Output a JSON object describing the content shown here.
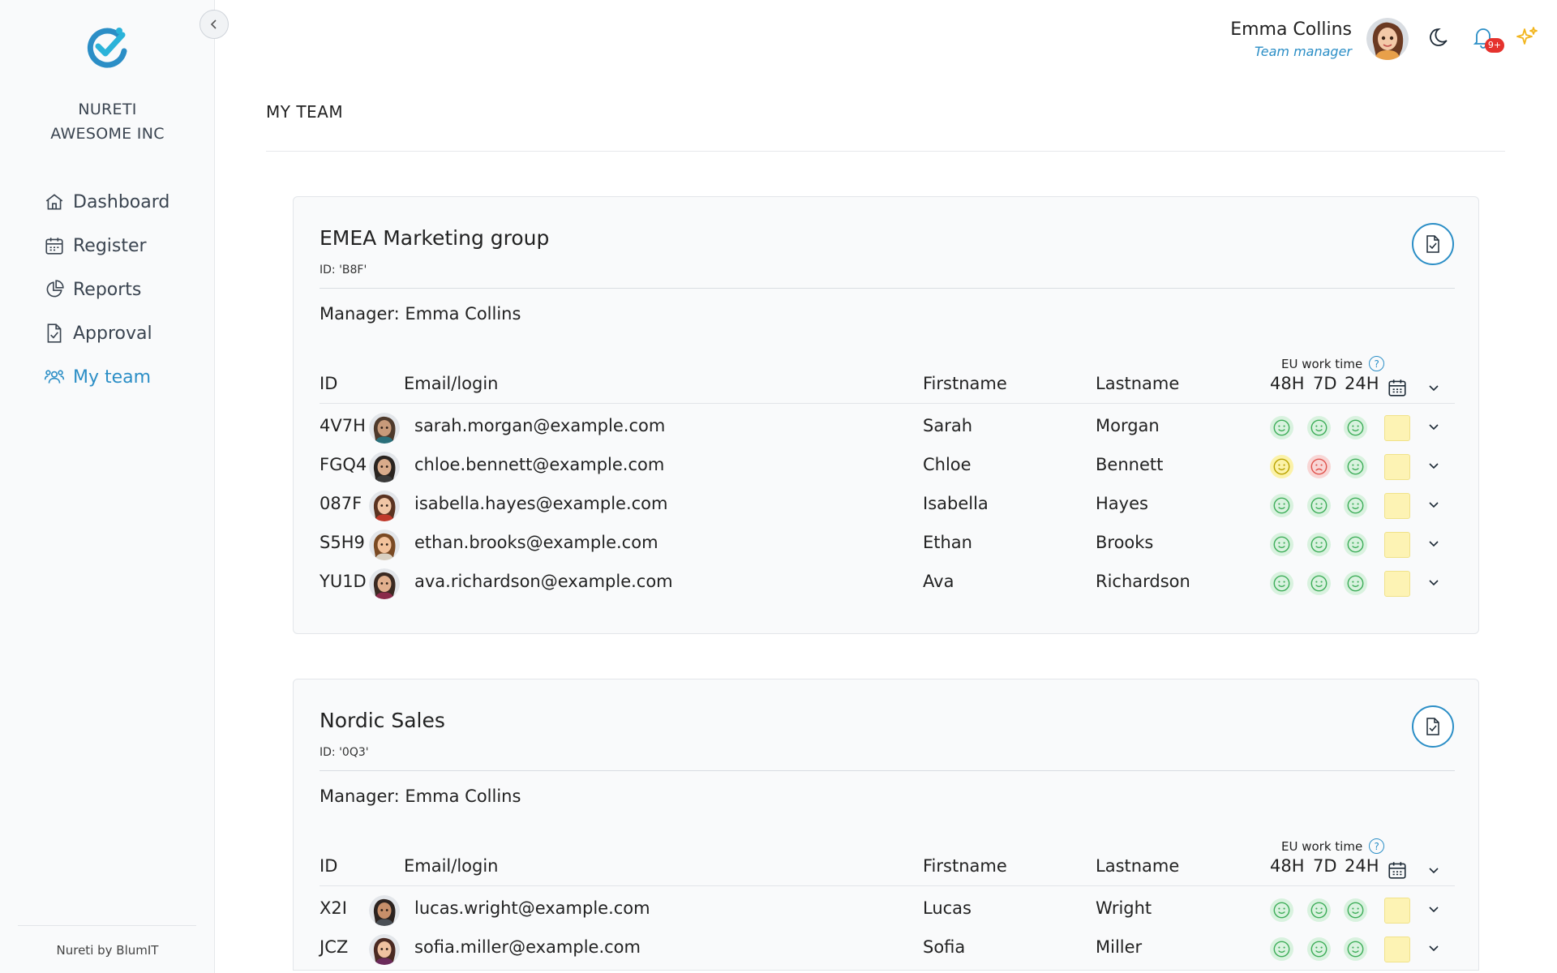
{
  "sidebar": {
    "org_line1": "NURETI",
    "org_line2": "AWESOME INC",
    "items": [
      {
        "label": "Dashboard",
        "icon": "home-icon",
        "active": false
      },
      {
        "label": "Register",
        "icon": "calendar-icon",
        "active": false
      },
      {
        "label": "Reports",
        "icon": "pie-chart-icon",
        "active": false
      },
      {
        "label": "Approval",
        "icon": "file-check-icon",
        "active": false
      },
      {
        "label": "My team",
        "icon": "users-icon",
        "active": true
      }
    ],
    "footer": "Nureti by BlumIT"
  },
  "header": {
    "user_name": "Emma Collins",
    "user_role": "Team manager",
    "notification_badge": "9+"
  },
  "page_title": "MY TEAM",
  "colors": {
    "accent": "#2b8ec6",
    "happy_face": "#3fae5a",
    "happy_bg": "#d9f2df",
    "neutral_face": "#b9a200",
    "neutral_bg": "#fbf2a8",
    "sad_face": "#e0544e",
    "sad_bg": "#f8d6d5",
    "status_box": "#fdf3b4",
    "badge": "#e5322d"
  },
  "columns": {
    "id": "ID",
    "email": "Email/login",
    "firstname": "Firstname",
    "lastname": "Lastname",
    "eu_work_time": "EU work time",
    "h48": "48H",
    "d7": "7D",
    "h24": "24H",
    "help": "?"
  },
  "groups": [
    {
      "name": "EMEA Marketing group",
      "id_text": "ID: 'B8F'",
      "manager": "Manager: Emma Collins",
      "members": [
        {
          "id": "4V7H",
          "email": "sarah.morgan@example.com",
          "firstname": "Sarah",
          "lastname": "Morgan",
          "status": [
            "happy",
            "happy",
            "happy"
          ]
        },
        {
          "id": "FGQ4",
          "email": "chloe.bennett@example.com",
          "firstname": "Chloe",
          "lastname": "Bennett",
          "status": [
            "neutral",
            "sad",
            "happy"
          ]
        },
        {
          "id": "087F",
          "email": "isabella.hayes@example.com",
          "firstname": "Isabella",
          "lastname": "Hayes",
          "status": [
            "happy",
            "happy",
            "happy"
          ]
        },
        {
          "id": "S5H9",
          "email": "ethan.brooks@example.com",
          "firstname": "Ethan",
          "lastname": "Brooks",
          "status": [
            "happy",
            "happy",
            "happy"
          ]
        },
        {
          "id": "YU1D",
          "email": "ava.richardson@example.com",
          "firstname": "Ava",
          "lastname": "Richardson",
          "status": [
            "happy",
            "happy",
            "happy"
          ]
        }
      ]
    },
    {
      "name": "Nordic Sales",
      "id_text": "ID: '0Q3'",
      "manager": "Manager: Emma Collins",
      "members": [
        {
          "id": "X2I",
          "email": "lucas.wright@example.com",
          "firstname": "Lucas",
          "lastname": "Wright",
          "status": [
            "happy",
            "happy",
            "happy"
          ]
        },
        {
          "id": "JCZ",
          "email": "sofia.miller@example.com",
          "firstname": "Sofia",
          "lastname": "Miller",
          "status": [
            "happy",
            "happy",
            "happy"
          ]
        }
      ]
    }
  ]
}
